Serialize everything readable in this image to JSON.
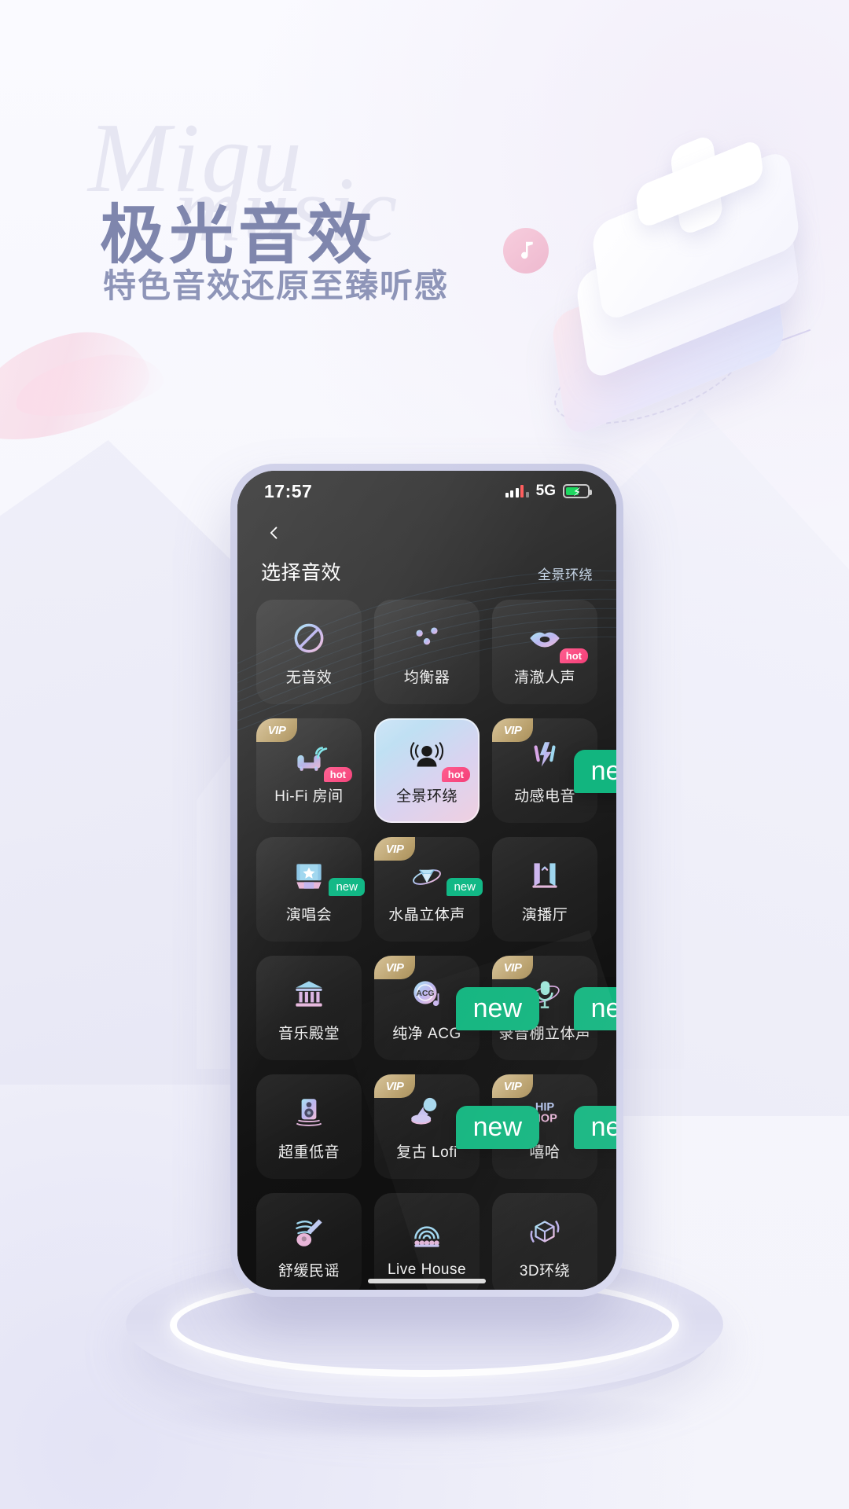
{
  "poster": {
    "wordmark_line1": "Migu",
    "wordmark_line2": "music",
    "headline": "极光音效",
    "subheadline": "特色音效还原至臻听感",
    "accent_color": "#7f86ad",
    "background_color": "#f7f7fc"
  },
  "phone": {
    "status_bar": {
      "time": "17:57",
      "network": "5G",
      "signal_icon": "signal-bars-icon",
      "battery_icon": "battery-charging-icon"
    },
    "nav": {
      "back_icon": "chevron-left-icon",
      "title": "选择音效",
      "current_effect": "全景环绕"
    },
    "effects": [
      {
        "label": "无音效",
        "icon": "no-effect-icon",
        "vip": false,
        "badge": "",
        "selected": false
      },
      {
        "label": "均衡器",
        "icon": "equalizer-icon",
        "vip": false,
        "badge": "",
        "selected": false
      },
      {
        "label": "清澈人声",
        "icon": "lips-icon",
        "vip": false,
        "badge": "hot",
        "selected": false
      },
      {
        "label": "Hi-Fi 房间",
        "icon": "sofa-signal-icon",
        "vip": true,
        "badge": "hot",
        "selected": false
      },
      {
        "label": "全景环绕",
        "icon": "surround-person-icon",
        "vip": false,
        "badge": "hot",
        "selected": true
      },
      {
        "label": "动感电音",
        "icon": "lightning-icon",
        "vip": true,
        "badge": "new-big",
        "selected": false
      },
      {
        "label": "演唱会",
        "icon": "concert-stage-icon",
        "vip": false,
        "badge": "new",
        "selected": false
      },
      {
        "label": "水晶立体声",
        "icon": "diamond-orbit-icon",
        "vip": true,
        "badge": "new",
        "selected": false
      },
      {
        "label": "演播厅",
        "icon": "studio-hall-icon",
        "vip": false,
        "badge": "",
        "selected": false
      },
      {
        "label": "音乐殿堂",
        "icon": "temple-icon",
        "vip": false,
        "badge": "",
        "selected": false
      },
      {
        "label": "纯净 ACG",
        "icon": "acg-disc-icon",
        "vip": true,
        "badge": "new-big",
        "selected": false
      },
      {
        "label": "录音棚立体声",
        "icon": "studio-mic-icon",
        "vip": true,
        "badge": "new-big",
        "selected": false
      },
      {
        "label": "超重低音",
        "icon": "subwoofer-icon",
        "vip": false,
        "badge": "",
        "selected": false
      },
      {
        "label": "复古 Lofi",
        "icon": "gramophone-icon",
        "vip": true,
        "badge": "new-big",
        "selected": false
      },
      {
        "label": "嘻哈",
        "icon": "hiphop-text-icon",
        "vip": true,
        "badge": "new-big",
        "selected": false
      },
      {
        "label": "舒缓民谣",
        "icon": "guitar-icon",
        "vip": false,
        "badge": "",
        "selected": false
      },
      {
        "label": "Live House",
        "icon": "livehouse-icon",
        "vip": false,
        "badge": "",
        "selected": false
      },
      {
        "label": "3D环绕",
        "icon": "cube-3d-icon",
        "vip": false,
        "badge": "",
        "selected": false
      }
    ],
    "badge_labels": {
      "vip": "VIP",
      "hot": "hot",
      "new": "new"
    },
    "colors": {
      "badge_new": "#12b886",
      "badge_hot": "#f43f78",
      "badge_vip": "#b89f6b"
    }
  }
}
